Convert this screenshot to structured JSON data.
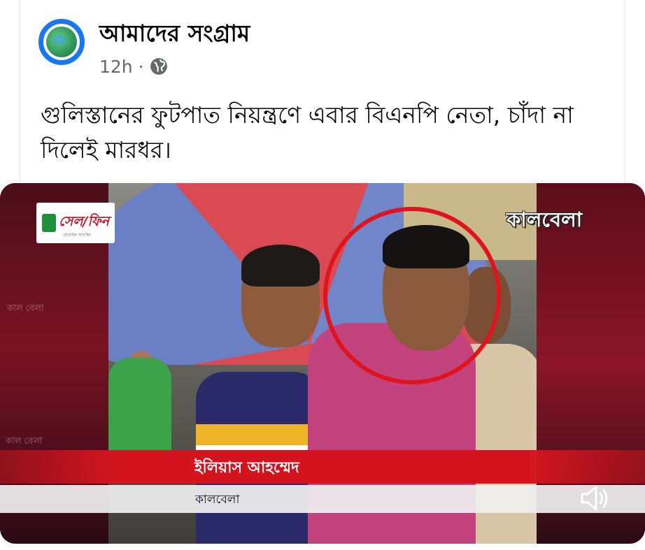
{
  "post": {
    "page_name": "আমাদের সংগ্রাম",
    "time": "12h",
    "separator": "·",
    "audience_icon": "globe-icon",
    "text": "গুলিস্তানের ফুটপাত নিয়ন্ত্রণে এবার বিএনপি নেতা, চাঁদা না দিলেই মারধর।"
  },
  "video": {
    "sponsor_logo_text": "সেল/ফিন",
    "sponsor_logo_subtext": "মোবাইল ব্যাংকিং",
    "channel_logo_text": "কালবেলা",
    "lower_third_name": "ইলিয়াস আহম্মেদ",
    "lower_third_source": "কালবেলা",
    "ghost_text_left_1": "কাল বেলা",
    "ghost_text_left_2": "কাল বেলা",
    "volume_icon": "speaker-icon",
    "accent_red": "#d3141f",
    "circle_red": "#e0141d"
  },
  "colors": {
    "text_primary": "#050505",
    "text_secondary": "#65676b",
    "avatar_ring": "#1877f2"
  }
}
